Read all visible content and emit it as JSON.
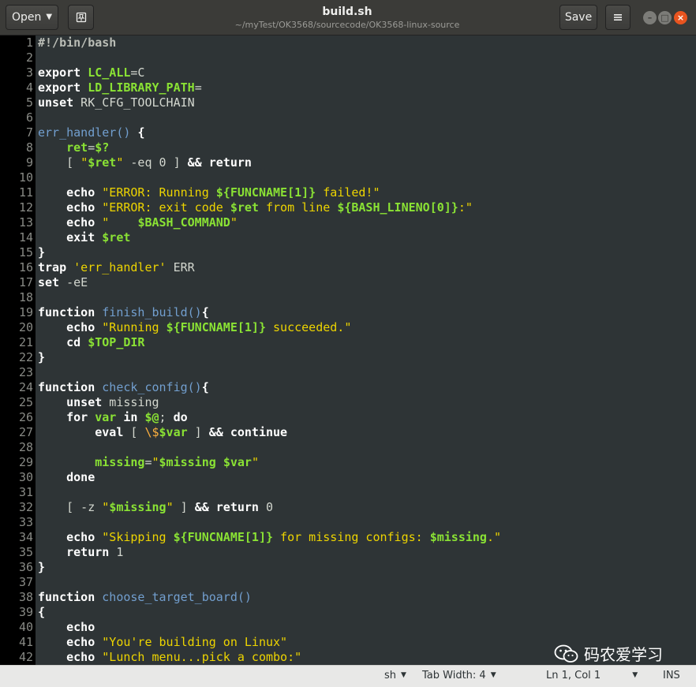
{
  "header": {
    "open_label": "Open",
    "title": "build.sh",
    "subtitle": "~/myTest/OK3568/sourcecode/OK3568-linux-source",
    "save_label": "Save",
    "icons": [
      "pin-icon",
      "hamburger-menu-icon",
      "minimize-icon",
      "maximize-icon",
      "close-icon"
    ]
  },
  "colors": {
    "keyword": "#ffffff",
    "string": "#edd400",
    "variable": "#8ae234",
    "function_name": "#729fcf",
    "comment": "#babdb6",
    "escape": "#fcaf3e"
  },
  "editor": {
    "lines": [
      {
        "num": "1",
        "tokens": [
          {
            "t": "#!/bin/bash",
            "c": "sh"
          }
        ]
      },
      {
        "num": "2",
        "tokens": []
      },
      {
        "num": "3",
        "tokens": [
          {
            "t": "export",
            "c": "k"
          },
          {
            "t": " "
          },
          {
            "t": "LC_ALL",
            "c": "v"
          },
          {
            "t": "=C"
          }
        ]
      },
      {
        "num": "4",
        "tokens": [
          {
            "t": "export",
            "c": "k"
          },
          {
            "t": " "
          },
          {
            "t": "LD_LIBRARY_PATH",
            "c": "v"
          },
          {
            "t": "="
          }
        ]
      },
      {
        "num": "5",
        "tokens": [
          {
            "t": "unset",
            "c": "k"
          },
          {
            "t": " RK_CFG_TOOLCHAIN"
          }
        ]
      },
      {
        "num": "6",
        "tokens": []
      },
      {
        "num": "7",
        "tokens": [
          {
            "t": "err_handler()",
            "c": "f"
          },
          {
            "t": " "
          },
          {
            "t": "{",
            "c": "k"
          }
        ]
      },
      {
        "num": "8",
        "tokens": [
          {
            "t": "    "
          },
          {
            "t": "ret",
            "c": "v"
          },
          {
            "t": "="
          },
          {
            "t": "$?",
            "c": "v"
          }
        ]
      },
      {
        "num": "9",
        "tokens": [
          {
            "t": "    [ "
          },
          {
            "t": "\"",
            "c": "s"
          },
          {
            "t": "$ret",
            "c": "v"
          },
          {
            "t": "\"",
            "c": "s"
          },
          {
            "t": " -eq 0 ] "
          },
          {
            "t": "&&",
            "c": "k"
          },
          {
            "t": " "
          },
          {
            "t": "return",
            "c": "k"
          }
        ]
      },
      {
        "num": "10",
        "tokens": []
      },
      {
        "num": "11",
        "tokens": [
          {
            "t": "    "
          },
          {
            "t": "echo",
            "c": "k"
          },
          {
            "t": " "
          },
          {
            "t": "\"ERROR: Running ",
            "c": "s"
          },
          {
            "t": "${FUNCNAME[1]}",
            "c": "v"
          },
          {
            "t": " failed!\"",
            "c": "s"
          }
        ]
      },
      {
        "num": "12",
        "tokens": [
          {
            "t": "    "
          },
          {
            "t": "echo",
            "c": "k"
          },
          {
            "t": " "
          },
          {
            "t": "\"ERROR: exit code ",
            "c": "s"
          },
          {
            "t": "$ret",
            "c": "v"
          },
          {
            "t": " from line ",
            "c": "s"
          },
          {
            "t": "${BASH_LINENO[0]}",
            "c": "v"
          },
          {
            "t": ":\"",
            "c": "s"
          }
        ]
      },
      {
        "num": "13",
        "tokens": [
          {
            "t": "    "
          },
          {
            "t": "echo",
            "c": "k"
          },
          {
            "t": " "
          },
          {
            "t": "\"    ",
            "c": "s"
          },
          {
            "t": "$BASH_COMMAND",
            "c": "v"
          },
          {
            "t": "\"",
            "c": "s"
          }
        ]
      },
      {
        "num": "14",
        "tokens": [
          {
            "t": "    "
          },
          {
            "t": "exit",
            "c": "k"
          },
          {
            "t": " "
          },
          {
            "t": "$ret",
            "c": "v"
          }
        ]
      },
      {
        "num": "15",
        "tokens": [
          {
            "t": "}",
            "c": "k"
          }
        ]
      },
      {
        "num": "16",
        "tokens": [
          {
            "t": "trap",
            "c": "k"
          },
          {
            "t": " "
          },
          {
            "t": "'err_handler'",
            "c": "s"
          },
          {
            "t": " ERR"
          }
        ]
      },
      {
        "num": "17",
        "tokens": [
          {
            "t": "set",
            "c": "k"
          },
          {
            "t": " -eE"
          }
        ]
      },
      {
        "num": "18",
        "tokens": []
      },
      {
        "num": "19",
        "tokens": [
          {
            "t": "function",
            "c": "k"
          },
          {
            "t": " "
          },
          {
            "t": "finish_build()",
            "c": "f"
          },
          {
            "t": "{",
            "c": "k"
          }
        ]
      },
      {
        "num": "20",
        "tokens": [
          {
            "t": "    "
          },
          {
            "t": "echo",
            "c": "k"
          },
          {
            "t": " "
          },
          {
            "t": "\"Running ",
            "c": "s"
          },
          {
            "t": "${FUNCNAME[1]}",
            "c": "v"
          },
          {
            "t": " succeeded.\"",
            "c": "s"
          }
        ]
      },
      {
        "num": "21",
        "tokens": [
          {
            "t": "    "
          },
          {
            "t": "cd",
            "c": "k"
          },
          {
            "t": " "
          },
          {
            "t": "$TOP_DIR",
            "c": "v"
          }
        ]
      },
      {
        "num": "22",
        "tokens": [
          {
            "t": "}",
            "c": "k"
          }
        ]
      },
      {
        "num": "23",
        "tokens": []
      },
      {
        "num": "24",
        "tokens": [
          {
            "t": "function",
            "c": "k"
          },
          {
            "t": " "
          },
          {
            "t": "check_config()",
            "c": "f"
          },
          {
            "t": "{",
            "c": "k"
          }
        ]
      },
      {
        "num": "25",
        "tokens": [
          {
            "t": "    "
          },
          {
            "t": "unset",
            "c": "k"
          },
          {
            "t": " missing"
          }
        ]
      },
      {
        "num": "26",
        "tokens": [
          {
            "t": "    "
          },
          {
            "t": "for",
            "c": "k"
          },
          {
            "t": " "
          },
          {
            "t": "var",
            "c": "v"
          },
          {
            "t": " "
          },
          {
            "t": "in",
            "c": "k"
          },
          {
            "t": " "
          },
          {
            "t": "$@",
            "c": "v"
          },
          {
            "t": "; "
          },
          {
            "t": "do",
            "c": "k"
          }
        ]
      },
      {
        "num": "27",
        "tokens": [
          {
            "t": "        "
          },
          {
            "t": "eval",
            "c": "k"
          },
          {
            "t": " [ "
          },
          {
            "t": "\\$",
            "c": "e"
          },
          {
            "t": "$var",
            "c": "v"
          },
          {
            "t": " ] "
          },
          {
            "t": "&&",
            "c": "k"
          },
          {
            "t": " "
          },
          {
            "t": "continue",
            "c": "k"
          }
        ]
      },
      {
        "num": "28",
        "tokens": []
      },
      {
        "num": "29",
        "tokens": [
          {
            "t": "        "
          },
          {
            "t": "missing",
            "c": "v"
          },
          {
            "t": "="
          },
          {
            "t": "\"",
            "c": "s"
          },
          {
            "t": "$missing",
            "c": "v"
          },
          {
            "t": " ",
            "c": "s"
          },
          {
            "t": "$var",
            "c": "v"
          },
          {
            "t": "\"",
            "c": "s"
          }
        ]
      },
      {
        "num": "30",
        "tokens": [
          {
            "t": "    "
          },
          {
            "t": "done",
            "c": "k"
          }
        ]
      },
      {
        "num": "31",
        "tokens": []
      },
      {
        "num": "32",
        "tokens": [
          {
            "t": "    [ -z "
          },
          {
            "t": "\"",
            "c": "s"
          },
          {
            "t": "$missing",
            "c": "v"
          },
          {
            "t": "\"",
            "c": "s"
          },
          {
            "t": " ] "
          },
          {
            "t": "&&",
            "c": "k"
          },
          {
            "t": " "
          },
          {
            "t": "return",
            "c": "k"
          },
          {
            "t": " 0"
          }
        ]
      },
      {
        "num": "33",
        "tokens": []
      },
      {
        "num": "34",
        "tokens": [
          {
            "t": "    "
          },
          {
            "t": "echo",
            "c": "k"
          },
          {
            "t": " "
          },
          {
            "t": "\"Skipping ",
            "c": "s"
          },
          {
            "t": "${FUNCNAME[1]}",
            "c": "v"
          },
          {
            "t": " for missing configs: ",
            "c": "s"
          },
          {
            "t": "$missing",
            "c": "v"
          },
          {
            "t": ".\"",
            "c": "s"
          }
        ]
      },
      {
        "num": "35",
        "tokens": [
          {
            "t": "    "
          },
          {
            "t": "return",
            "c": "k"
          },
          {
            "t": " 1"
          }
        ]
      },
      {
        "num": "36",
        "tokens": [
          {
            "t": "}",
            "c": "k"
          }
        ]
      },
      {
        "num": "37",
        "tokens": []
      },
      {
        "num": "38",
        "tokens": [
          {
            "t": "function",
            "c": "k"
          },
          {
            "t": " "
          },
          {
            "t": "choose_target_board()",
            "c": "f"
          }
        ]
      },
      {
        "num": "39",
        "tokens": [
          {
            "t": "{",
            "c": "k"
          }
        ]
      },
      {
        "num": "40",
        "tokens": [
          {
            "t": "    "
          },
          {
            "t": "echo",
            "c": "k"
          }
        ]
      },
      {
        "num": "41",
        "tokens": [
          {
            "t": "    "
          },
          {
            "t": "echo",
            "c": "k"
          },
          {
            "t": " "
          },
          {
            "t": "\"You're building on Linux\"",
            "c": "s"
          }
        ]
      },
      {
        "num": "42",
        "tokens": [
          {
            "t": "    "
          },
          {
            "t": "echo",
            "c": "k"
          },
          {
            "t": " "
          },
          {
            "t": "\"Lunch menu...pick a combo:\"",
            "c": "s"
          }
        ]
      }
    ]
  },
  "statusbar": {
    "language": "sh",
    "tab_width": "Tab Width: 4",
    "position": "Ln 1, Col 1",
    "mode": "INS"
  },
  "watermark": {
    "text": "码农爱学习",
    "icon": "wechat-icon"
  }
}
